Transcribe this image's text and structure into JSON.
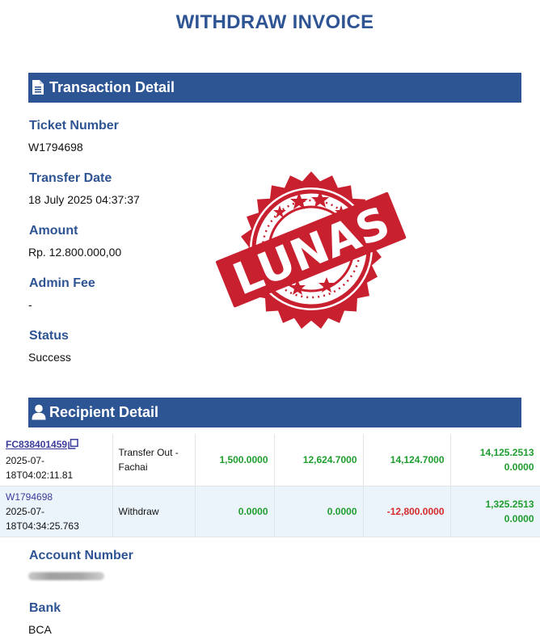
{
  "page_title": "WITHDRAW INVOICE",
  "transaction_section": {
    "heading": "Transaction Detail",
    "icon": "document-icon",
    "fields": [
      {
        "label": "Ticket Number",
        "value": "W1794698"
      },
      {
        "label": "Transfer Date",
        "value": "18 July 2025 04:37:37"
      },
      {
        "label": "Amount",
        "value": "Rp. 12.800.000,00"
      },
      {
        "label": "Admin Fee",
        "value": "-"
      },
      {
        "label": "Status",
        "value": "Success"
      }
    ]
  },
  "stamp": {
    "text": "LUNAS",
    "color": "#c8202f"
  },
  "recipient_section": {
    "heading": "Recipient Detail",
    "icon": "user-icon"
  },
  "ledger": {
    "rows": [
      {
        "ref": "FC838401459",
        "date": "2025-07-",
        "time": "18T04:02:11.81",
        "type": "Transfer Out - Fachai",
        "c1": "1,500.0000",
        "c2": "12,624.7000",
        "c3": "14,124.7000",
        "c4a": "14,125.2513",
        "c4b": "0.0000"
      },
      {
        "ref": "W1794698",
        "date": "2025-07-",
        "time": "18T04:34:25.763",
        "type": "Withdraw",
        "c1": "0.0000",
        "c2": "0.0000",
        "c3": "-12,800.0000",
        "c4a": "1,325.2513",
        "c4b": "0.0000"
      }
    ],
    "colors": {
      "positive": "#1f9d2e",
      "negative": "#d42a2a",
      "link": "#3b3b9b"
    }
  },
  "account_fields": [
    {
      "label": "Account Number",
      "value_redacted": true
    },
    {
      "label": "Bank",
      "value": "BCA"
    }
  ],
  "colors": {
    "brand": "#2d5593",
    "label": "#2e5494"
  }
}
